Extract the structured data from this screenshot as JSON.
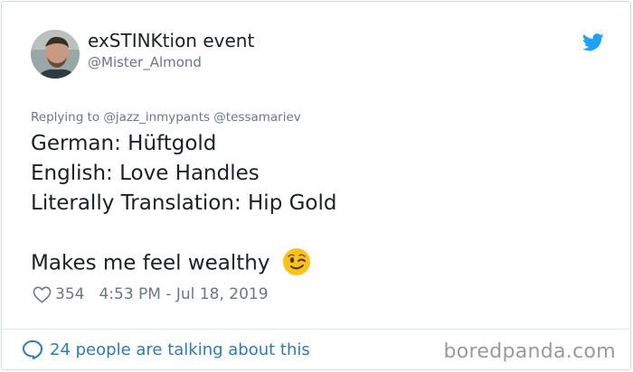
{
  "user": {
    "display_name": "exSTINKtion event",
    "handle": "@Mister_Almond"
  },
  "tweet": {
    "replying_to": "Replying to @jazz_inmypants @tessamariev",
    "lines": [
      "German: Hüftgold",
      "English: Love Handles",
      "Literally Translation: Hip Gold"
    ],
    "closing_line": "Makes me feel wealthy",
    "emoji": "winking-face-emoji",
    "likes": "354",
    "timestamp": "4:53 PM - Jul 18, 2019"
  },
  "footer": {
    "talking_text": "24 people are talking about this",
    "watermark": "boredpanda.com"
  },
  "colors": {
    "twitter_blue": "#1da1f2",
    "link_blue": "#2b7bb9",
    "text_primary": "#1c2022",
    "text_secondary": "#697882",
    "border": "#d4dbe1"
  },
  "icons": {
    "brand": "twitter-bird-icon",
    "like": "heart-icon",
    "reply": "speech-bubble-icon"
  }
}
